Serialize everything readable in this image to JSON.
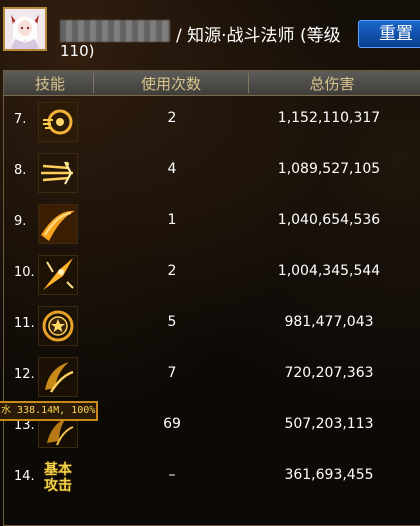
{
  "header": {
    "title_line1": "/ 知源·战斗法师 (等级",
    "title_line2": "110)",
    "reset_button_label": "重置"
  },
  "table": {
    "columns": [
      "技能",
      "使用次数",
      "总伤害"
    ],
    "rows": [
      {
        "rank": "7.",
        "icon": "wheel-skill-icon",
        "count": "2",
        "damage": "1,152,110,317"
      },
      {
        "rank": "8.",
        "icon": "speed-rush-skill-icon",
        "count": "4",
        "damage": "1,089,527,105"
      },
      {
        "rank": "9.",
        "icon": "crescent-slash-icon",
        "count": "1",
        "damage": "1,040,654,536"
      },
      {
        "rank": "10.",
        "icon": "flame-burst-icon",
        "count": "2",
        "damage": "1,004,345,544"
      },
      {
        "rank": "11.",
        "icon": "star-orb-icon",
        "count": "5",
        "damage": "981,477,043"
      },
      {
        "rank": "12.",
        "icon": "swirl-wing-icon",
        "count": "7",
        "damage": "720,207,363"
      },
      {
        "rank": "13.",
        "icon": "swirl-claw-icon",
        "count": "69",
        "damage": "507,203,113"
      },
      {
        "rank": "14.",
        "icon": "basic-attack-icon",
        "count": "–",
        "damage": "361,693,455",
        "icon_text": "基本\n攻击"
      }
    ]
  },
  "tooltip": {
    "text": "水 338.14M, 100%"
  },
  "colors": {
    "header_text": "#d7c28a",
    "button_blue": "#1a66c9",
    "tooltip_border": "#c98a1a",
    "tooltip_text": "#ffd54a"
  }
}
